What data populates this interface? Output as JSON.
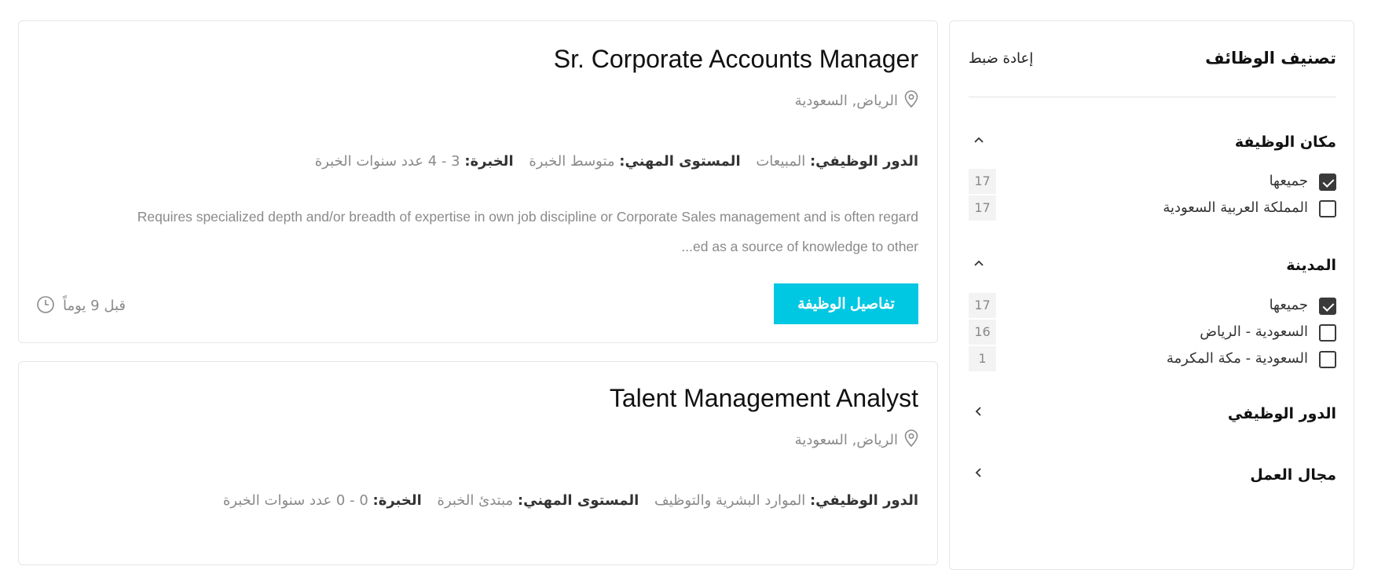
{
  "filters": {
    "title": "تصنيف الوظائف",
    "reset_label": "إعادة ضبط",
    "sections": [
      {
        "label": "مكان الوظيفة",
        "expanded": true,
        "options": [
          {
            "label": "جميعها",
            "count": "17",
            "checked": true
          },
          {
            "label": "المملكة العربية السعودية",
            "count": "17",
            "checked": false
          }
        ]
      },
      {
        "label": "المدينة",
        "expanded": true,
        "options": [
          {
            "label": "جميعها",
            "count": "17",
            "checked": true
          },
          {
            "label": "السعودية - الرياض",
            "count": "16",
            "checked": false
          },
          {
            "label": "السعودية - مكة المكرمة",
            "count": "1",
            "checked": false
          }
        ]
      },
      {
        "label": "الدور الوظيفي",
        "expanded": false
      },
      {
        "label": "مجال العمل",
        "expanded": false
      }
    ]
  },
  "jobs": [
    {
      "title": "Sr. Corporate Accounts Manager",
      "location": "الرياض, السعودية",
      "role_key": "الدور الوظيفي:",
      "role_value": "المبيعات",
      "level_key": "المستوى المهني:",
      "level_value": "متوسط الخبرة",
      "exp_key": "الخبرة:",
      "exp_value": "3 - 4 عدد سنوات الخبرة",
      "description_line1": "Requires specialized depth and/or breadth of expertise in own job discipline or Corporate Sales management and is often regard",
      "description_line2": "...ed as a source of knowledge to other",
      "details_button": "تفاصيل الوظيفة",
      "posted": "قبل 9 يوماً"
    },
    {
      "title": "Talent Management Analyst",
      "location": "الرياض, السعودية",
      "role_key": "الدور الوظيفي:",
      "role_value": "الموارد البشرية والتوظيف",
      "level_key": "المستوى المهني:",
      "level_value": "مبتدئ الخبرة",
      "exp_key": "الخبرة:",
      "exp_value": "0 - 0 عدد سنوات الخبرة"
    }
  ]
}
